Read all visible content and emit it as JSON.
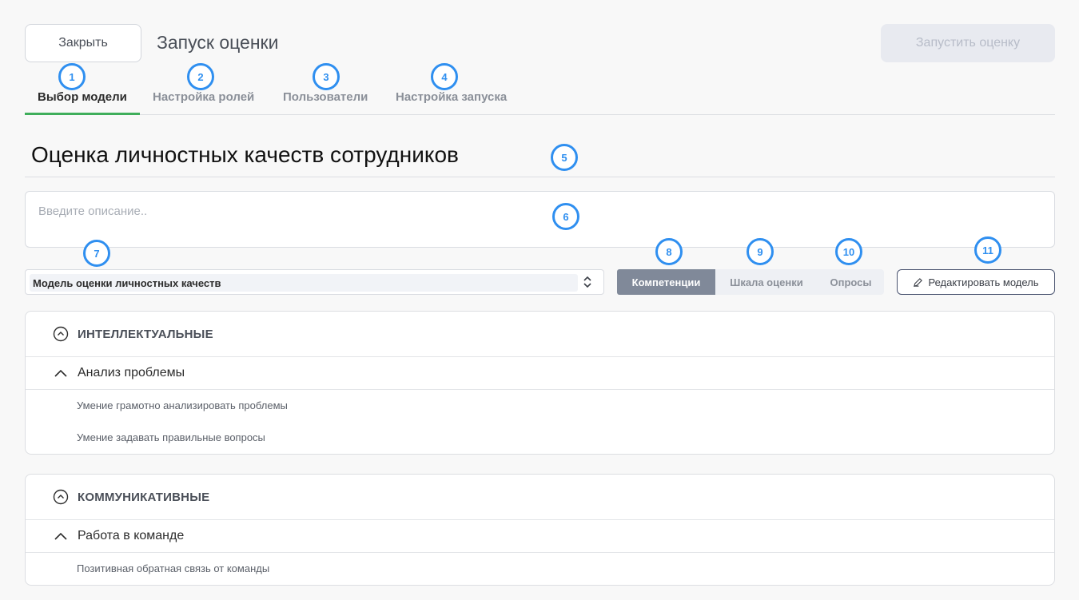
{
  "header": {
    "close_label": "Закрыть",
    "title": "Запуск оценки",
    "launch_label": "Запустить оценку"
  },
  "tabs": [
    {
      "label": "Выбор модели",
      "active": true
    },
    {
      "label": "Настройка ролей",
      "active": false
    },
    {
      "label": "Пользователи",
      "active": false
    },
    {
      "label": "Настройка запуска",
      "active": false
    }
  ],
  "markers": [
    "1",
    "2",
    "3",
    "4",
    "5",
    "6",
    "7",
    "8",
    "9",
    "10",
    "11"
  ],
  "model": {
    "title": "Оценка личностных качеств сотрудников",
    "description_placeholder": "Введите описание..",
    "select_value": "Модель оценки личностных качеств"
  },
  "view_switch": {
    "items": [
      "Компетенции",
      "Шкала оценки",
      "Опросы"
    ],
    "active_index": 0
  },
  "edit_label": "Редактировать модель",
  "categories": [
    {
      "name": "ИНТЕЛЛЕКТУАЛЬНЫЕ",
      "competency": "Анализ проблемы",
      "indicators": [
        "Умение грамотно анализировать проблемы",
        "Умение задавать правильные вопросы"
      ]
    },
    {
      "name": "КОММУНИКАТИВНЫЕ",
      "competency": "Работа в команде",
      "indicators": [
        "Позитивная обратная связь от команды"
      ]
    }
  ],
  "colors": {
    "accent_tab": "#3fae5b",
    "marker": "#2f8ff0",
    "segment_active": "#808999"
  }
}
